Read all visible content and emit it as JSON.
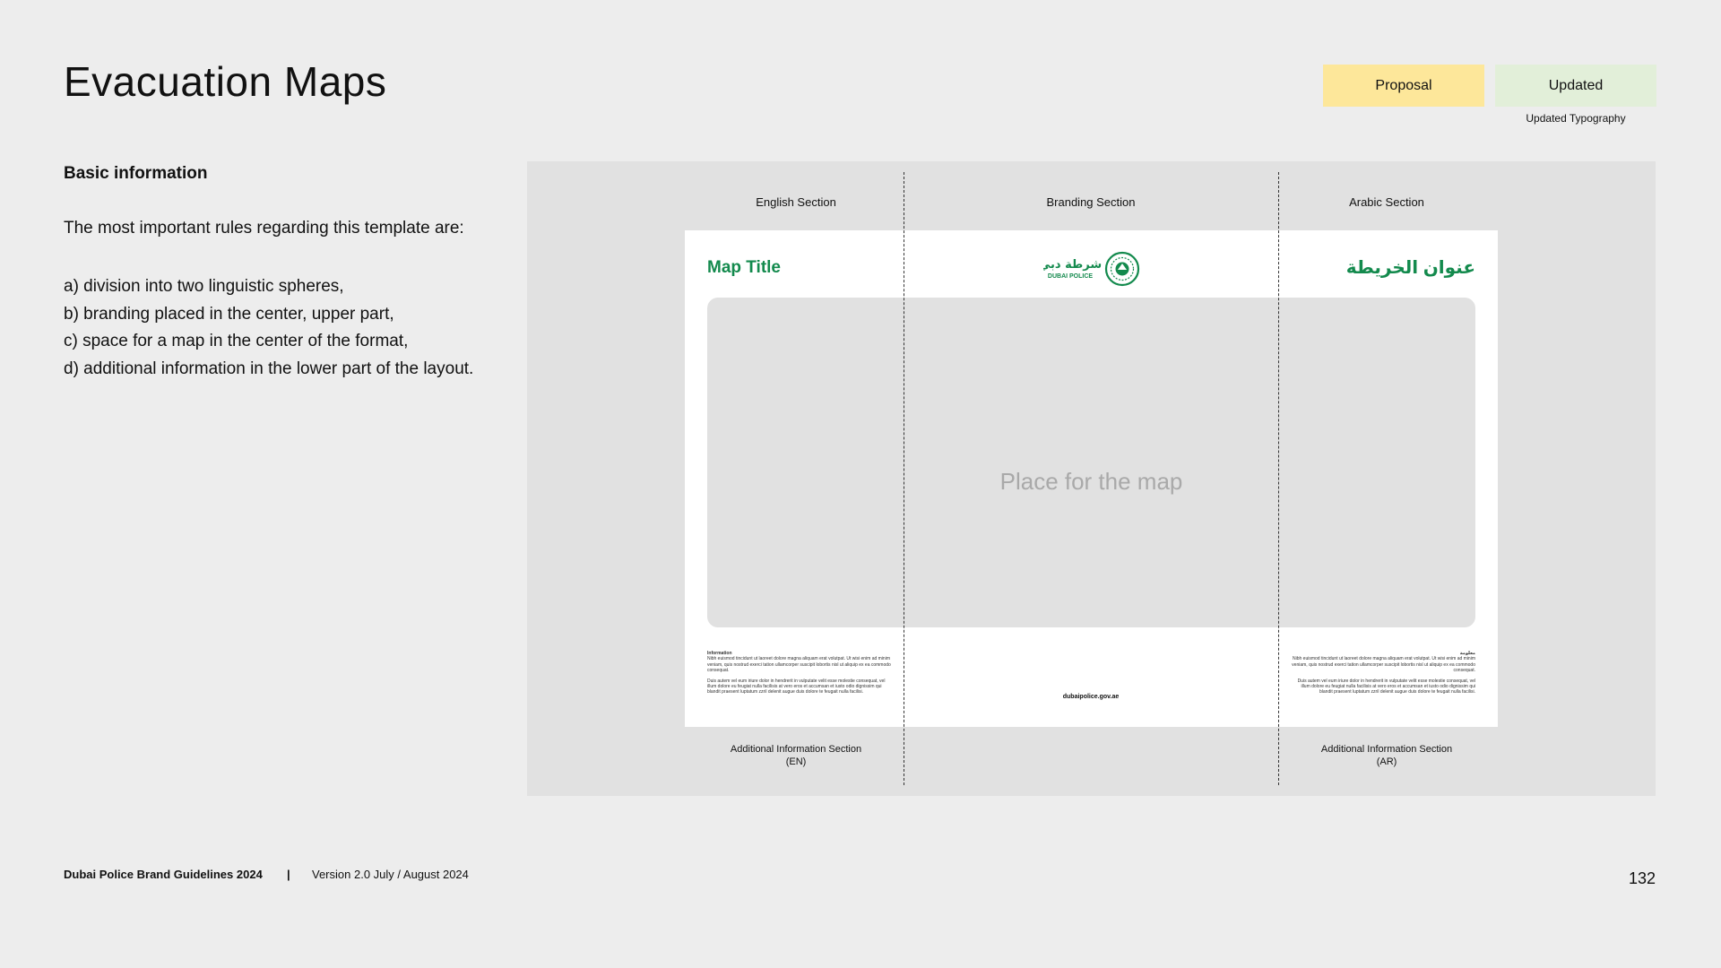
{
  "header": {
    "title": "Evacuation Maps",
    "status_badges": [
      {
        "label": "Proposal",
        "color": "#fde79a"
      },
      {
        "label": "Updated",
        "color": "#e2efd9"
      }
    ],
    "updated_note": "Updated Typography"
  },
  "sidebar": {
    "heading": "Basic information",
    "intro": "The most important rules regarding this template are:",
    "rules": [
      "a) division into two linguistic spheres,",
      "b) branding placed in the center, upper part,",
      "c) space for a map in the center of the format,",
      "d) additional information in the lower part of the layout."
    ]
  },
  "diagram": {
    "panel_color": "#e1e1e1",
    "sections": {
      "english": "English Section",
      "branding": "Branding Section",
      "arabic": "Arabic Section"
    },
    "template": {
      "title_en": "Map Title",
      "title_ar": "عنوان الخريطة",
      "brand_color": "#138a4d",
      "logo": {
        "name": "dubai-police-logo",
        "arabic_text": "شرطة دبي",
        "english_text": "DUBAI POLICE"
      },
      "map_placeholder": "Place for the map",
      "info_en": {
        "heading": "Information",
        "paragraph_1": "Nibh euismod tincidunt ut laoreet dolore magna aliquam erat volutpat. Ut wisi enim ad minim veniam, quis nostrud exerci tation ullamcorper suscipit lobortis nisl ut aliquip ex ea commodo consequat.",
        "paragraph_2": "Duis autem vel eum iriure dolor in hendrerit in vulputate velit esse molestie consequat, vel illum dolore eu feugiat nulla facilisis at vero eros et accumsan et iusto odio dignissim qui blandit praesent luptatum zzril delenit augue duis dolore te feugait nulla facilisi."
      },
      "info_ar": {
        "heading": "معلومة",
        "paragraph_1": "Nibh euismod tincidunt ut laoreet dolore magna aliquam erat volutpat. Ut wisi enim ad minim veniam, quis nostrud exerci tation ullamcorper suscipit lobortis nisl ut aliquip ex ea commodo consequat.",
        "paragraph_2": "Duis autem vel eum iriure dolor in hendrerit in vulputate velit esse molestie consequat, vel illum dolore eu feugiat nulla facilisis at vero eros et accumsan et iusto odio dignissim qui blandit praesent luptatum zzril delenit augue duis dolore te feugait nulla facilisi."
      },
      "website": "dubaipolice.gov.ae"
    },
    "additional_en": [
      "Additional Information Section",
      "(EN)"
    ],
    "additional_ar": [
      "Additional Information Section",
      "(AR)"
    ]
  },
  "footer": {
    "brand": "Dubai Police Brand Guidelines 2024",
    "separator": "|",
    "version": "Version 2.0 July / August 2024",
    "page_number": "132"
  }
}
